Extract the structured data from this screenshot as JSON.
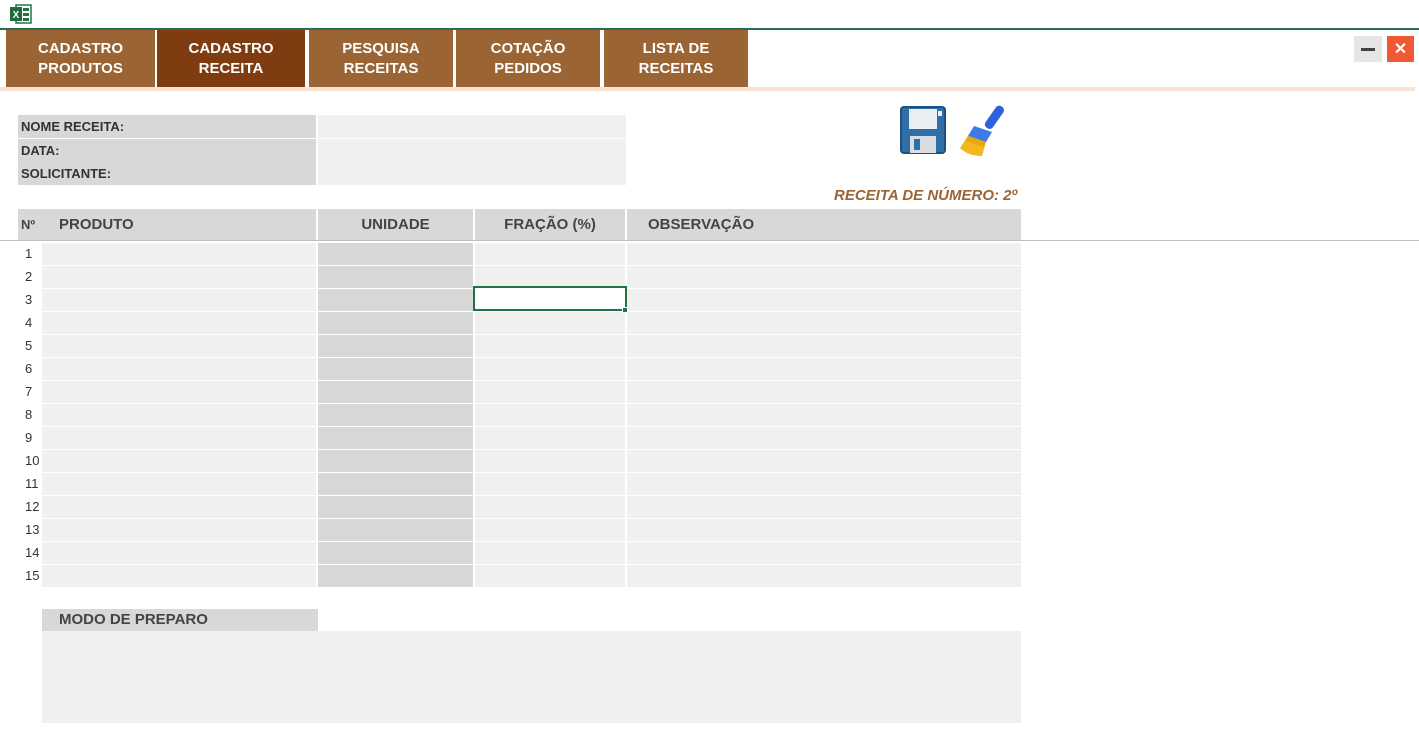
{
  "app": {
    "icon": "excel-icon",
    "brand_color": "#217346"
  },
  "tabs": [
    {
      "label": "CADASTRO\nPRODUTOS",
      "active": false
    },
    {
      "label": "CADASTRO\nRECEITA",
      "active": true
    },
    {
      "label": "PESQUISA\nRECEITAS",
      "active": false
    },
    {
      "label": "COTAÇÃO\nPEDIDOS",
      "active": false
    },
    {
      "label": "LISTA DE\nRECEITAS",
      "active": false
    }
  ],
  "colors": {
    "tab": "#9a6434",
    "tab_active": "#7f3c10",
    "accent_text": "#9a6434",
    "close": "#ef5a34"
  },
  "window": {
    "minimize_icon": "minimize-icon",
    "close_icon": "close-icon",
    "close_glyph": "✕"
  },
  "form": {
    "nome_receita_label": "NOME RECEITA:",
    "nome_receita_value": "",
    "data_label": "DATA:",
    "data_value": "",
    "solicitante_label": "SOLICITANTE:",
    "solicitante_value": ""
  },
  "actions": {
    "save_icon": "floppy-disk-icon",
    "clear_icon": "broom-icon"
  },
  "recipe_number": "RECEITA DE NÚMERO: 2º",
  "table": {
    "columns": {
      "num": "Nº",
      "produto": "PRODUTO",
      "unidade": "UNIDADE",
      "fracao": "FRAÇÃO (%)",
      "observacao": "OBSERVAÇÃO"
    },
    "rows": [
      "1",
      "2",
      "3",
      "4",
      "5",
      "6",
      "7",
      "8",
      "9",
      "10",
      "11",
      "12",
      "13",
      "14",
      "15"
    ],
    "selected_row": 3,
    "selected_column": "fracao"
  },
  "preparo": {
    "label": "MODO DE PREPARO",
    "value": ""
  }
}
